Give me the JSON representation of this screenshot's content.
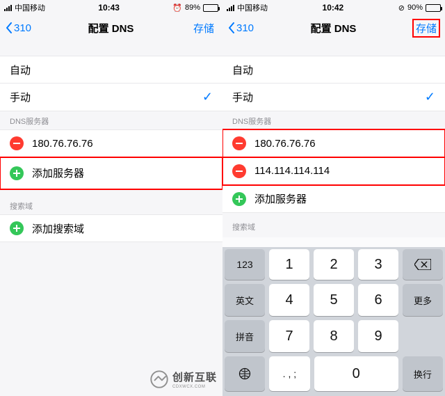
{
  "left": {
    "status": {
      "carrier": "中国移动",
      "time": "10:43",
      "battery": "89%"
    },
    "nav": {
      "back": "310",
      "title": "配置 DNS",
      "save": "存储"
    },
    "mode": {
      "auto": "自动",
      "manual": "手动"
    },
    "dns_header": "DNS服务器",
    "dns_items": [
      "180.76.76.76"
    ],
    "dns_add": "添加服务器",
    "search_header": "搜索域",
    "search_add": "添加搜索域"
  },
  "right": {
    "status": {
      "carrier": "中国移动",
      "time": "10:42",
      "battery": "90%"
    },
    "nav": {
      "back": "310",
      "title": "配置 DNS",
      "save": "存储"
    },
    "mode": {
      "auto": "自动",
      "manual": "手动"
    },
    "dns_header": "DNS服务器",
    "dns_items": [
      "180.76.76.76",
      "114.114.114.114"
    ],
    "dns_add": "添加服务器",
    "search_header": "搜索域"
  },
  "keyboard": {
    "r1": [
      "123",
      "1",
      "2",
      "3"
    ],
    "r2": [
      "英文",
      "4",
      "5",
      "6",
      "更多"
    ],
    "r3": [
      "拼音",
      "7",
      "8",
      "9"
    ],
    "r4": [
      ". , ;",
      "0",
      "换行"
    ]
  },
  "brand": {
    "name": "创新互联",
    "sub": "CDXWCX.COM"
  },
  "icons": {
    "alarm": "⏰",
    "orient": "⊘"
  }
}
